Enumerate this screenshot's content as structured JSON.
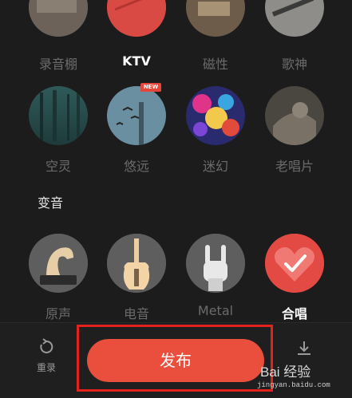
{
  "effects": {
    "row1": [
      "录音棚",
      "KTV",
      "磁性",
      "歌神"
    ],
    "row2": [
      "空灵",
      "悠远",
      "迷幻",
      "老唱片"
    ],
    "new_badge": "NEW"
  },
  "voice_section": {
    "title": "变音",
    "items": [
      "原声",
      "电音",
      "Metal",
      "合唱"
    ]
  },
  "bottom_bar": {
    "rerecord_label": "重录",
    "publish_label": "发布"
  },
  "watermark": {
    "text": "Bai 经验",
    "url": "jingyan.baidu.com"
  },
  "colors": {
    "accent": "#ea4e3d",
    "highlight_box": "#e3211d",
    "background": "#1c1c1d"
  }
}
